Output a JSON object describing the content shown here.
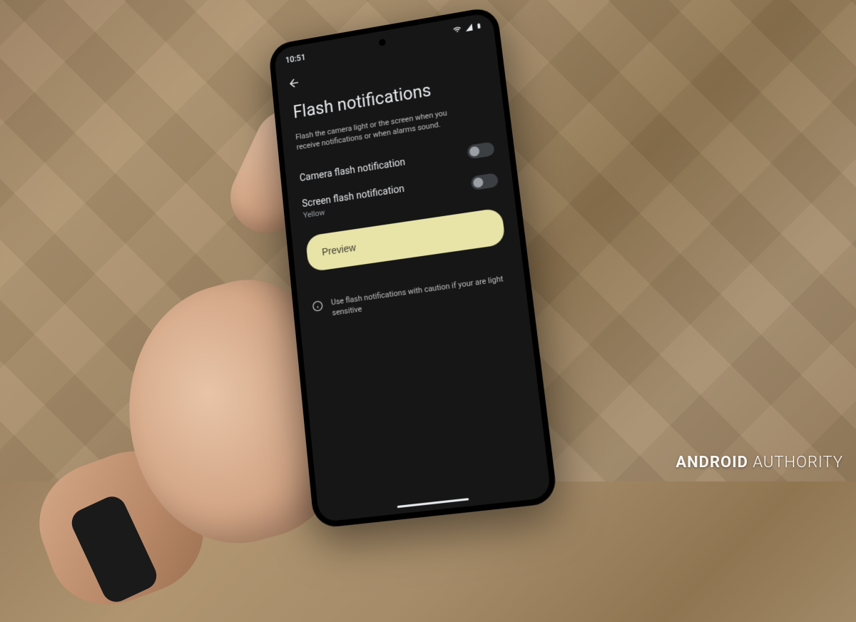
{
  "status_bar": {
    "time": "10:51"
  },
  "page": {
    "title": "Flash notifications",
    "description": "Flash the camera light or the screen when you receive notifications or when alarms sound."
  },
  "settings": {
    "camera_flash": {
      "label": "Camera flash notification",
      "enabled": false
    },
    "screen_flash": {
      "label": "Screen flash notification",
      "sublabel": "Yellow",
      "enabled": false,
      "color": "#e8e4a8"
    }
  },
  "preview_button": "Preview",
  "caution": "Use flash notifications with caution if your are light sensitive",
  "watermark": {
    "brand": "ANDROID",
    "suffix": "AUTHORITY"
  }
}
